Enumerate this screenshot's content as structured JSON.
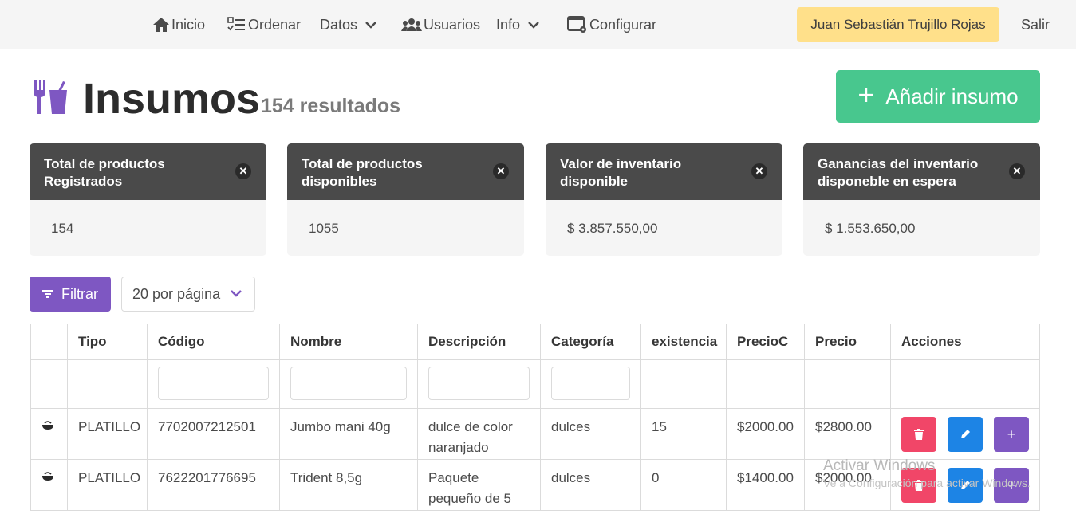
{
  "navbar": {
    "items": [
      {
        "label": "Inicio",
        "icon": "home-icon"
      },
      {
        "label": "Ordenar",
        "icon": "checklist-icon"
      },
      {
        "label": "Datos",
        "icon": "chevron-down-icon"
      },
      {
        "label": "Usuarios",
        "icon": "users-icon"
      },
      {
        "label": "Info",
        "icon": "chevron-down-icon"
      },
      {
        "label": "Configurar",
        "icon": "settings-window-icon"
      }
    ],
    "user": "Juan Sebastián Trujillo Rojas",
    "logout": "Salir"
  },
  "page": {
    "title": "Insumos",
    "result_count": "154 resultados",
    "add_button": "Añadir insumo",
    "icon": "utensils-drink-icon",
    "accent": "#7e57c2"
  },
  "stats": [
    {
      "title": "Total de productos Registrados",
      "value": "154"
    },
    {
      "title": "Total de productos disponibles",
      "value": "1055"
    },
    {
      "title": "Valor de inventario disponible",
      "value": "$ 3.857.550,00"
    },
    {
      "title": "Ganancias del inventario disponeble en espera",
      "value": "$ 1.553.650,00"
    }
  ],
  "controls": {
    "filter_label": "Filtrar",
    "per_page": "20 por página"
  },
  "table": {
    "headers": [
      "",
      "Tipo",
      "Código",
      "Nombre",
      "Descripción",
      "Categoría",
      "existencia",
      "PrecioC",
      "Precio",
      "Acciones"
    ],
    "rows": [
      {
        "tipo": "PLATILLO",
        "codigo": "7702007212501",
        "nombre": "Jumbo mani 40g",
        "descripcion": "dulce de color naranjado",
        "categoria": "dulces",
        "existencia": "15",
        "precioc": "$2000.00",
        "precio": "$2800.00"
      },
      {
        "tipo": "PLATILLO",
        "codigo": "7622201776695",
        "nombre": "Trident 8,5g",
        "descripcion": "Paquete pequeño de 5",
        "categoria": "dulces",
        "existencia": "0",
        "precioc": "$1400.00",
        "precio": "$2000.00"
      }
    ]
  },
  "watermark": {
    "line1": "Activar Windows",
    "line2": "Ve a Configuración para activar Windows."
  }
}
